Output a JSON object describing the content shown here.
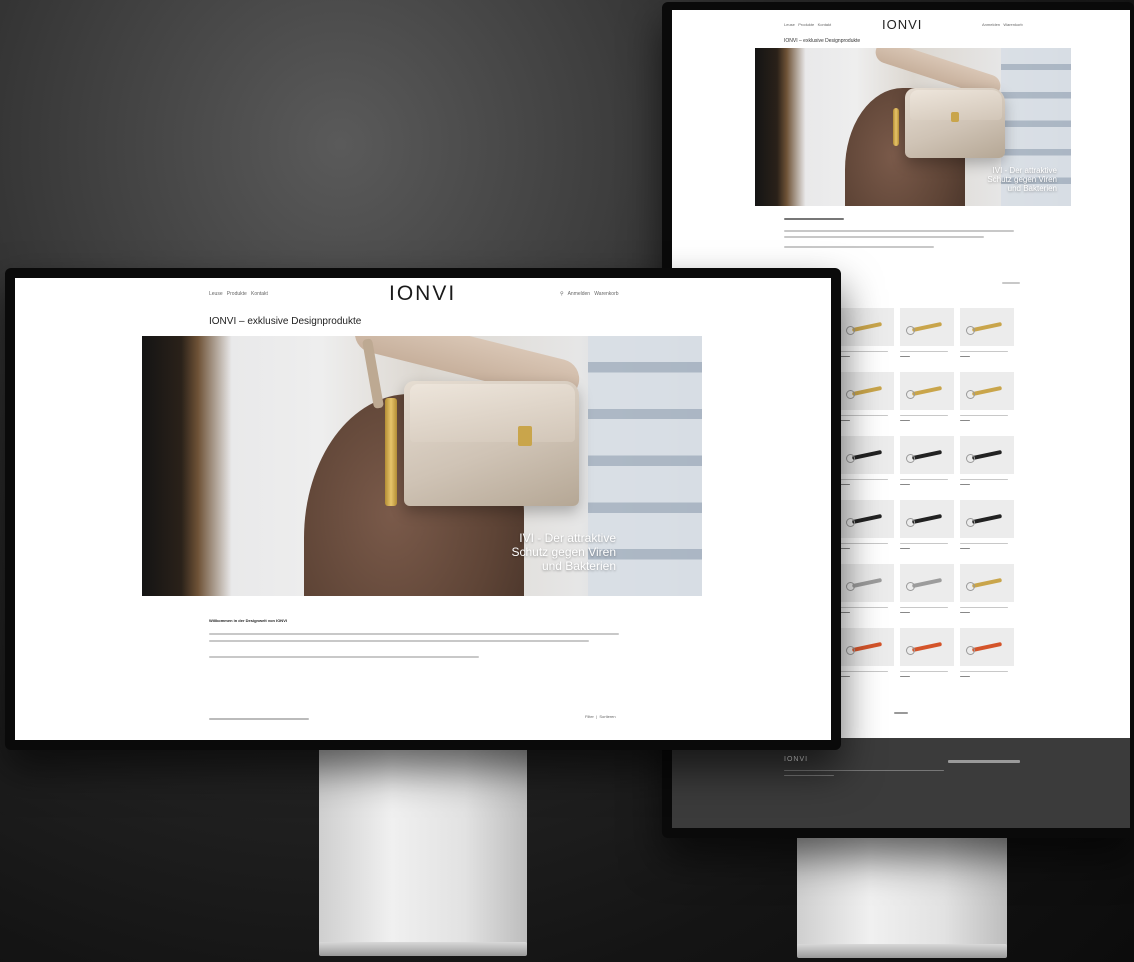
{
  "front_screen": {
    "nav_left": [
      "Leuse",
      "Produkte",
      "Kontakt"
    ],
    "logo": "IONVI",
    "nav_right": [
      "Anmelden",
      "Warenkorb"
    ],
    "page_title": "IONVI – exklusive Designprodukte",
    "hero_text": [
      "IVI - Der attraktive",
      "Schutz gegen Viren",
      "und Bakterien"
    ],
    "welcome_heading": "Willkommen in der Designwelt von IONVI",
    "filter_labels": [
      "Filter",
      "Sortieren"
    ]
  },
  "back_screen": {
    "logo": "IONVI",
    "page_title": "IONVI – exklusive Designprodukte",
    "hero_text": [
      "IVI - Der attraktive",
      "Schutz gegen Viren",
      "und Bakterien"
    ],
    "footer_logo": "IONVI"
  },
  "colors": {
    "gold": "#c9a54b",
    "black": "#222222",
    "silver": "#9c9c9c",
    "orange": "#d4542a"
  },
  "product_key_colors": [
    "gold",
    "gold",
    "gold",
    "gold",
    "gold",
    "gold",
    "black",
    "black",
    "black",
    "black",
    "black",
    "black",
    "silver",
    "silver",
    "gold",
    "orange",
    "orange",
    "orange"
  ]
}
